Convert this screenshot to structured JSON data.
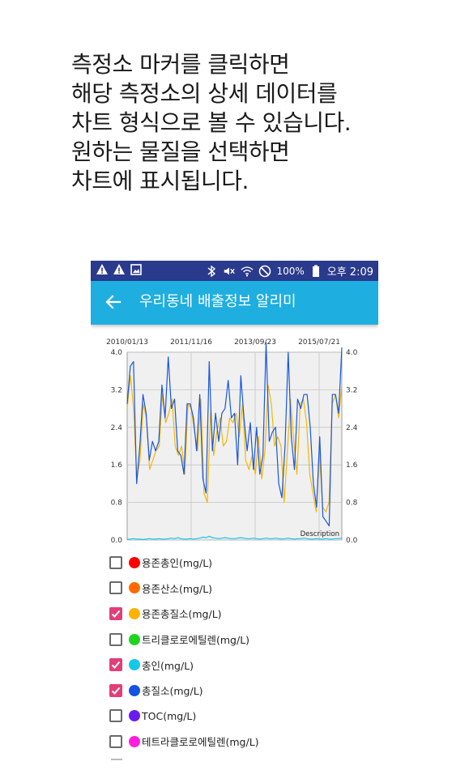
{
  "intro": {
    "lines": [
      "측정소 마커를 클릭하면",
      "해당 측정소의 상세 데이터를",
      "차트 형식으로 볼 수 있습니다.",
      "원하는 물질을 선택하면",
      "차트에 표시됩니다."
    ]
  },
  "status_bar": {
    "battery": "100%",
    "time": "오후 2:09",
    "icons": [
      "warning-icon",
      "warning-icon",
      "image-icon",
      "bluetooth-icon",
      "mute-icon",
      "wifi-icon",
      "do-not-disturb-icon",
      "battery-icon"
    ]
  },
  "app_bar": {
    "title": "우리동네 배출정보 알리미",
    "back_icon": "arrow-back-icon"
  },
  "chart_data": {
    "type": "line",
    "x_tick_labels": [
      "2010/01/13",
      "2011/11/16",
      "2013/09/23",
      "2015/07/21"
    ],
    "y_ticks": [
      0.0,
      0.8,
      1.6,
      2.4,
      3.2,
      4.0
    ],
    "y_tick_labels": [
      "0.0",
      "0.8",
      "1.6",
      "2.4",
      "3.2",
      "4.0"
    ],
    "ylim": [
      0,
      4.0
    ],
    "grid": true,
    "description": "Description",
    "series": [
      {
        "color": "#f5b800",
        "values": [
          2.8,
          3.5,
          2.8,
          1.3,
          1.7,
          2.9,
          2.6,
          1.5,
          1.7,
          1.9,
          2.0,
          3.1,
          2.5,
          2.7,
          3.0,
          2.0,
          1.8,
          2.0,
          1.4,
          2.9,
          2.8,
          2.3,
          1.9,
          3.0,
          1.0,
          0.8,
          2.7,
          1.8,
          2.3,
          2.6,
          2.0,
          2.1,
          2.6,
          2.5,
          2.7,
          2.2,
          2.9,
          1.7,
          1.5,
          1.8,
          1.4,
          2.2,
          1.3,
          1.9,
          3.3,
          2.9,
          2.0,
          2.2,
          2.0,
          0.8,
          1.9,
          3.0,
          2.1,
          1.4,
          2.9,
          3.0,
          2.5,
          1.4,
          1.0,
          0.6,
          1.9,
          0.7,
          0.6,
          0.8,
          2.9,
          3.1,
          2.6,
          3.3
        ]
      },
      {
        "color": "#1a56db",
        "values": [
          2.9,
          3.7,
          3.8,
          1.2,
          2.0,
          3.1,
          2.7,
          1.7,
          2.1,
          1.9,
          2.1,
          3.3,
          2.6,
          3.9,
          2.8,
          3.0,
          1.9,
          1.8,
          1.4,
          2.9,
          2.9,
          2.6,
          1.9,
          3.1,
          1.3,
          1.0,
          3.8,
          1.9,
          2.7,
          2.1,
          2.7,
          2.8,
          3.4,
          2.6,
          2.7,
          1.6,
          3.5,
          2.6,
          1.9,
          2.5,
          1.5,
          2.4,
          1.4,
          1.8,
          4.2,
          2.1,
          2.3,
          2.4,
          1.2,
          0.9,
          2.0,
          4.0,
          2.2,
          1.5,
          3.0,
          2.8,
          3.1,
          3.1,
          2.4,
          1.2,
          0.7,
          2.2,
          0.5,
          0.4,
          0.3,
          3.1,
          3.1,
          2.7,
          4.1
        ]
      },
      {
        "color": "#16c6e8",
        "values": [
          0.01,
          0.02,
          0.03,
          0.02,
          0.02,
          0.01,
          0.02,
          0.03,
          0.02,
          0.02,
          0.03,
          0.02,
          0.02,
          0.03,
          0.04,
          0.03,
          0.05,
          0.03,
          0.02,
          0.02,
          0.03,
          0.02,
          0.03,
          0.04,
          0.06,
          0.05,
          0.08,
          0.05,
          0.04,
          0.03,
          0.04,
          0.05,
          0.04,
          0.03,
          0.03,
          0.04,
          0.05,
          0.04,
          0.03,
          0.03,
          0.04,
          0.03,
          0.02,
          0.03,
          0.04,
          0.03,
          0.03,
          0.04,
          0.03,
          0.02,
          0.03,
          0.04,
          0.03,
          0.02,
          0.03,
          0.03,
          0.04,
          0.03,
          0.02,
          0.02,
          0.03,
          0.02,
          0.02,
          0.03,
          0.02,
          0.02,
          0.03,
          0.03,
          0.04
        ]
      }
    ]
  },
  "checklist": [
    {
      "label": "용존총인(mg/L)",
      "color": "#ff0000",
      "checked": false
    },
    {
      "label": "용존산소(mg/L)",
      "color": "#ff6a00",
      "checked": false
    },
    {
      "label": "용존총질소(mg/L)",
      "color": "#ffb300",
      "checked": true
    },
    {
      "label": "트리클로로에틸렌(mg/L)",
      "color": "#1fd41f",
      "checked": false
    },
    {
      "label": "총인(mg/L)",
      "color": "#14c8e8",
      "checked": true
    },
    {
      "label": "총질소(mg/L)",
      "color": "#1553e0",
      "checked": true
    },
    {
      "label": "TOC(mg/L)",
      "color": "#6a1cf0",
      "checked": false
    },
    {
      "label": "테트라클로로에틸렌(mg/L)",
      "color": "#ff1ee0",
      "checked": false
    }
  ]
}
